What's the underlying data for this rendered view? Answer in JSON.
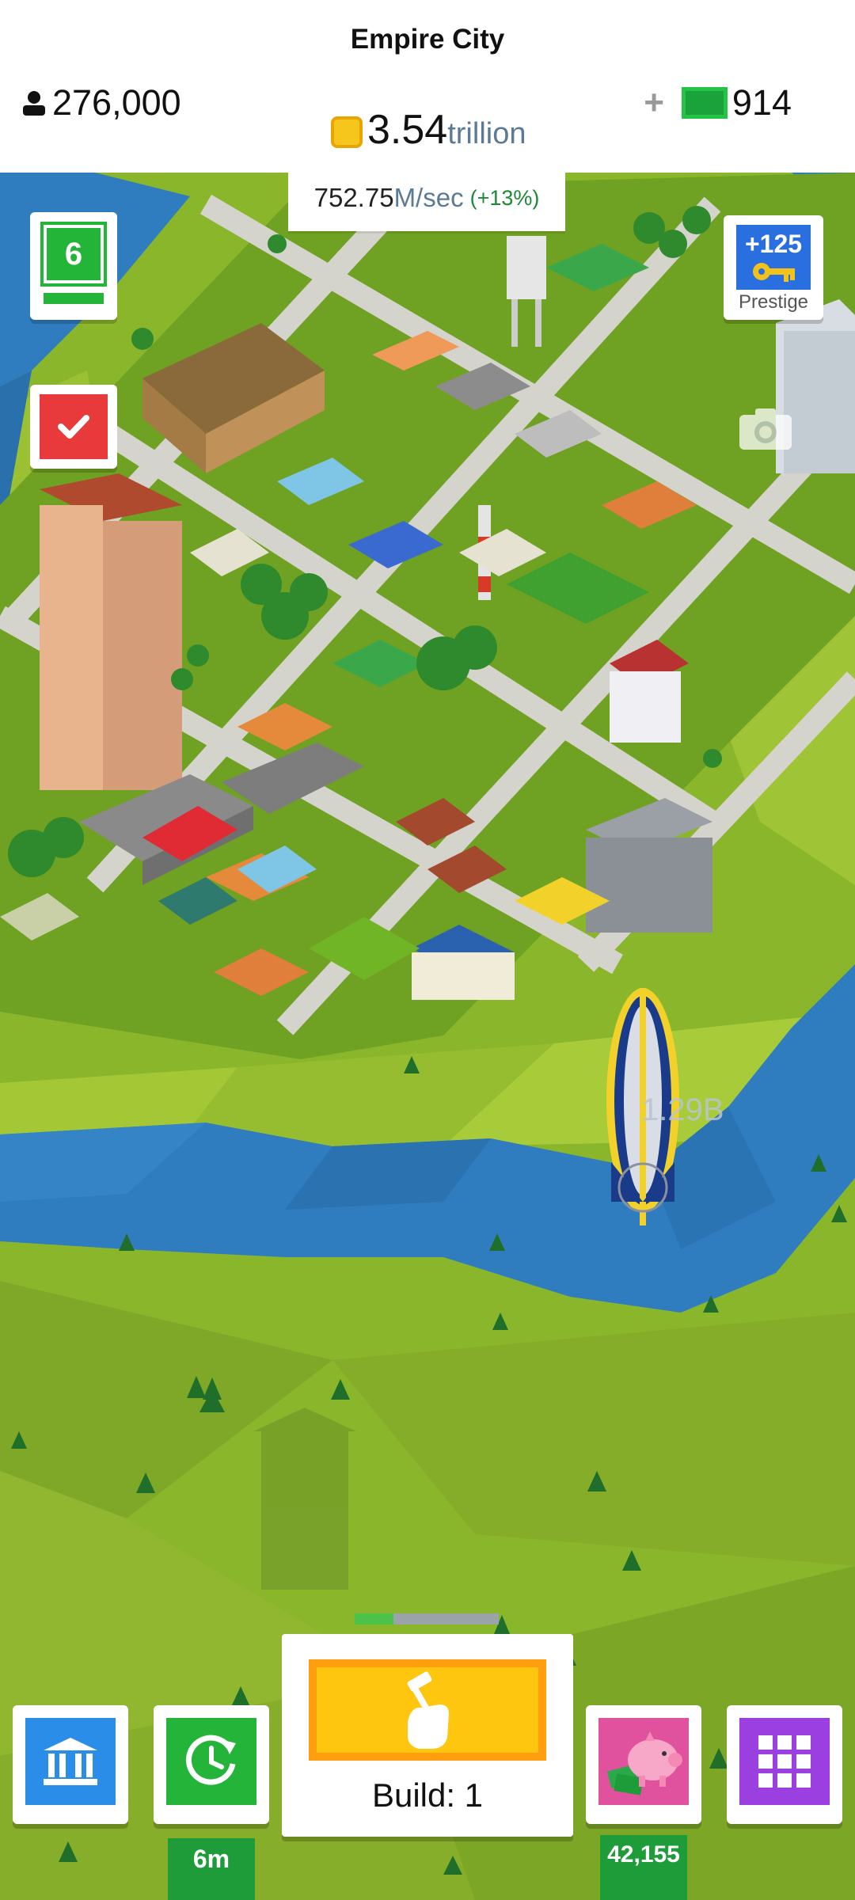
{
  "header": {
    "city_name": "Empire City",
    "population": "276,000",
    "coins_value": "3.54",
    "coins_unit": "trillion",
    "cash_plus": "+",
    "cash_value": "914"
  },
  "income": {
    "value": "752.75",
    "unit": "M/sec",
    "bonus": "(+13%)"
  },
  "side": {
    "level": "6",
    "prestige_count": "+125",
    "prestige_label": "Prestige"
  },
  "airship": {
    "reward": "1.29B"
  },
  "bottom": {
    "build_label": "Build: 1",
    "build_progress_fraction": 0.27,
    "boost_timer": "6m",
    "savings_amount": "42,155"
  },
  "colors": {
    "grass": "#8db32e",
    "river": "#2f7dbf",
    "bank": "#2a8de8",
    "boost": "#25b43a",
    "savings": "#e0529e",
    "menu": "#9b3fe0",
    "build": "#ffc60f"
  }
}
